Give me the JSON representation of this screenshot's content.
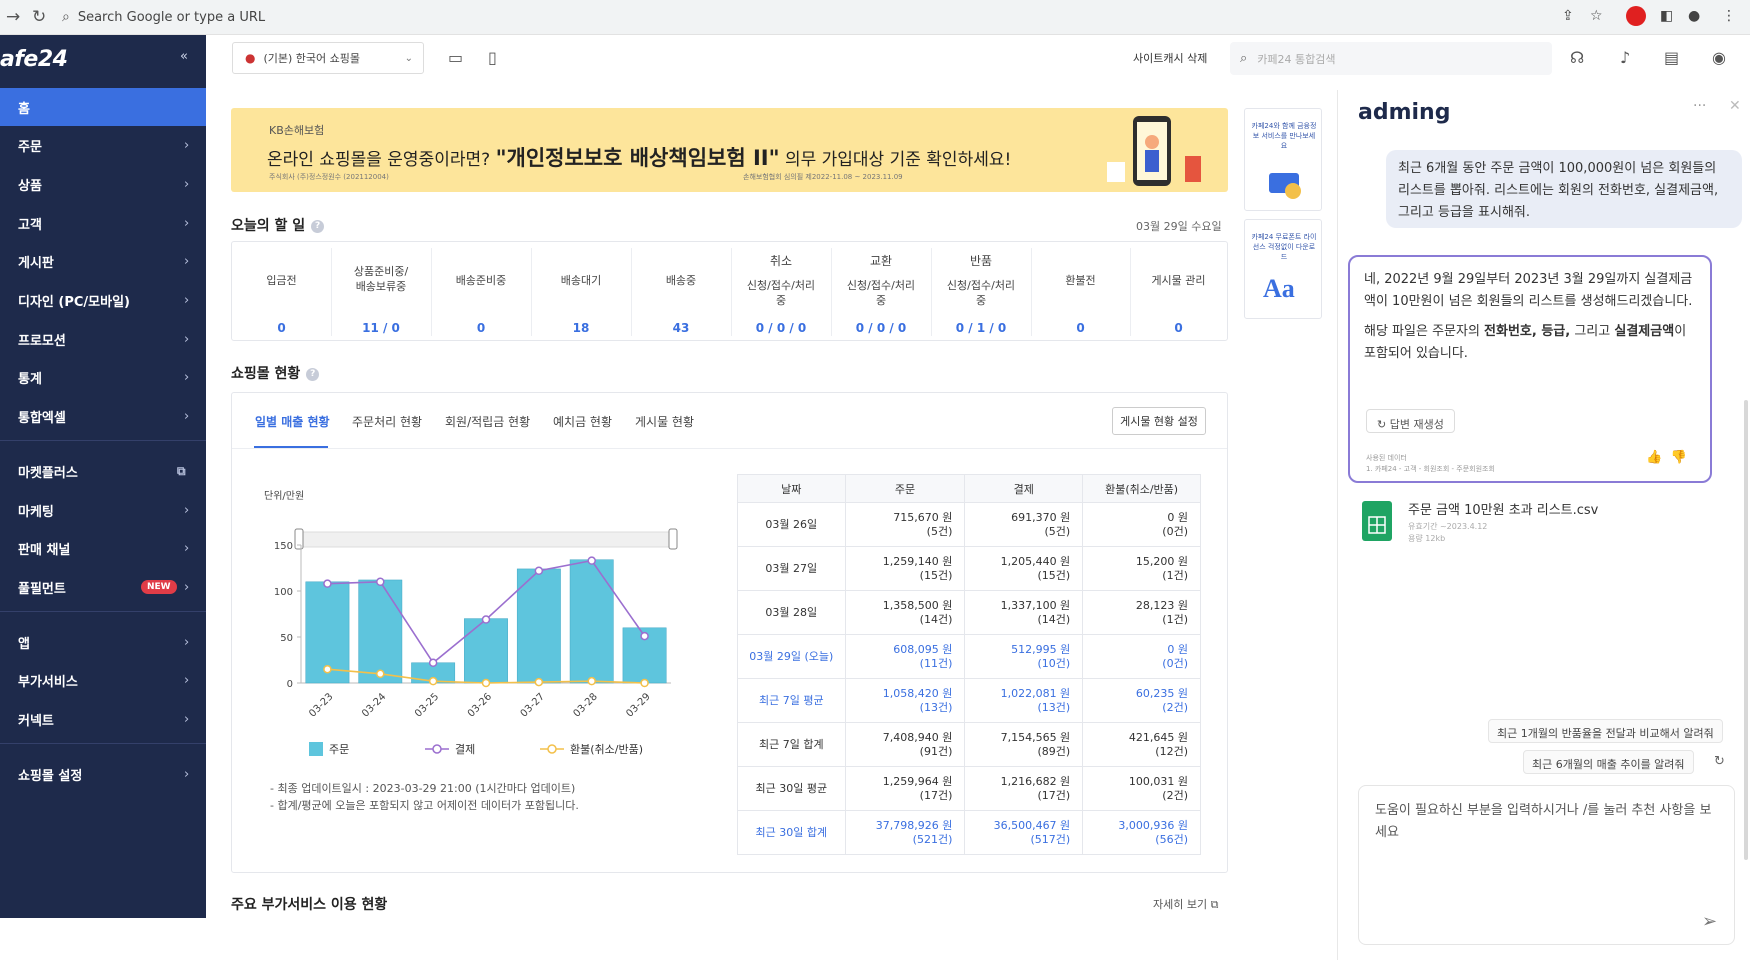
{
  "browser": {
    "url_placeholder": "Search Google or type a URL"
  },
  "sidebar": {
    "logo": "afe24",
    "items": [
      {
        "label": "홈"
      },
      {
        "label": "주문"
      },
      {
        "label": "상품"
      },
      {
        "label": "고객"
      },
      {
        "label": "게시판"
      },
      {
        "label": "디자인 (PC/모바일)"
      },
      {
        "label": "프로모션"
      },
      {
        "label": "통계"
      },
      {
        "label": "통합엑셀"
      },
      {
        "label": "마켓플러스"
      },
      {
        "label": "마케팅"
      },
      {
        "label": "판매 채널"
      },
      {
        "label": "풀필먼트",
        "badge": "NEW"
      },
      {
        "label": "앱"
      },
      {
        "label": "부가서비스"
      },
      {
        "label": "커넥트"
      },
      {
        "label": "쇼핑몰 설정"
      }
    ]
  },
  "header": {
    "shop_select": "(기본) 한국어 쇼핑몰",
    "site_cache": "사이트캐시 삭제",
    "search_placeholder": "카페24 통합검색"
  },
  "banner": {
    "brand": "KB손해보험",
    "lead": "온라인 쇼핑몰을 운영중이라면?",
    "highlight": "\"개인정보보호 배상책임보험 II\"",
    "tail": "의무 가입대상 기준 확인하세요!",
    "fine_left": "주식회사 (주)정스정원수 (202112004)",
    "fine_right": "손해보험협회 심의필 제2022-11.08 ~ 2023.11.09"
  },
  "side_ads": [
    {
      "text": "카페24와 함께 금융정보 서비스를 만나보세요"
    },
    {
      "text": "카페24 무료폰트 라이선스 걱정없이 다운로드"
    }
  ],
  "today": {
    "title": "오늘의 할 일",
    "date": "03월 29일 수요일",
    "columns": [
      {
        "label": "입금전",
        "value": "0"
      },
      {
        "label": "상품준비중/\n배송보류중",
        "value": "11 / 0"
      },
      {
        "label": "배송준비중",
        "value": "0"
      },
      {
        "label": "배송대기",
        "value": "18"
      },
      {
        "label": "배송중",
        "value": "43"
      },
      {
        "group": "취소",
        "label": "신청/접수/처리\n중",
        "value": "0 / 0 / 0"
      },
      {
        "group": "교환",
        "label": "신청/접수/처리\n중",
        "value": "0 / 0 / 0"
      },
      {
        "group": "반품",
        "label": "신청/접수/처리\n중",
        "value": "0 / 1 / 0"
      },
      {
        "label": "환불전",
        "value": "0"
      },
      {
        "label": "게시물 관리",
        "value": "0"
      }
    ]
  },
  "shop_status": {
    "title": "쇼핑몰 현황",
    "tabs": [
      "일별 매출 현황",
      "주문처리 현황",
      "회원/적립금 현황",
      "예치금 현황",
      "게시물 현황"
    ],
    "setting_button": "게시물 현황 설정",
    "unit_label": "단위/만원",
    "legend": [
      "주문",
      "결제",
      "환불(취소/반품)"
    ],
    "notes": [
      "- 최종 업데이트일시 : 2023-03-29 21:00 (1시간마다 업데이트)",
      "- 합계/평균에 오늘은 포함되지 않고 어제이전 데이터가 포함됩니다."
    ]
  },
  "chart_data": {
    "type": "bar",
    "categories": [
      "03-23",
      "03-24",
      "03-25",
      "03-26",
      "03-27",
      "03-28",
      "03-29"
    ],
    "series": [
      {
        "name": "주문",
        "type": "bar",
        "values": [
          110,
          112,
          22,
          70,
          124,
          134,
          60
        ]
      },
      {
        "name": "결제",
        "type": "line",
        "values": [
          108,
          110,
          22,
          69,
          122,
          133,
          51
        ]
      },
      {
        "name": "환불(취소/반품)",
        "type": "line",
        "values": [
          15,
          10,
          2,
          0,
          1,
          2,
          0
        ]
      }
    ],
    "xlabel": "",
    "ylabel": "단위/만원",
    "ylim": [
      0,
      150
    ],
    "yticks": [
      0,
      50,
      100,
      150
    ],
    "grid": false,
    "legend": "bottom",
    "colors": {
      "bar": "#5ec5dd",
      "line_pay": "#9b6fcf",
      "line_refund": "#f3c04a"
    }
  },
  "sales_table": {
    "headers": [
      "날짜",
      "주문",
      "결제",
      "환불(취소/반품)"
    ],
    "rows": [
      {
        "date": "03월 26일",
        "order": "715,670 원",
        "order_cnt": "(5건)",
        "pay": "691,370 원",
        "pay_cnt": "(5건)",
        "refund": "0 원",
        "refund_cnt": "(0건)"
      },
      {
        "date": "03월 27일",
        "order": "1,259,140 원",
        "order_cnt": "(15건)",
        "pay": "1,205,440 원",
        "pay_cnt": "(15건)",
        "refund": "15,200 원",
        "refund_cnt": "(1건)"
      },
      {
        "date": "03월 28일",
        "order": "1,358,500 원",
        "order_cnt": "(14건)",
        "pay": "1,337,100 원",
        "pay_cnt": "(14건)",
        "refund": "28,123 원",
        "refund_cnt": "(1건)"
      },
      {
        "date": "03월 29일 (오늘)",
        "order": "608,095 원",
        "order_cnt": "(11건)",
        "pay": "512,995 원",
        "pay_cnt": "(10건)",
        "refund": "0 원",
        "refund_cnt": "(0건)"
      },
      {
        "date": "최근 7일 평균",
        "order": "1,058,420 원",
        "order_cnt": "(13건)",
        "pay": "1,022,081 원",
        "pay_cnt": "(13건)",
        "refund": "60,235 원",
        "refund_cnt": "(2건)"
      },
      {
        "date": "최근 7일 합계",
        "order": "7,408,940 원",
        "order_cnt": "(91건)",
        "pay": "7,154,565 원",
        "pay_cnt": "(89건)",
        "refund": "421,645 원",
        "refund_cnt": "(12건)"
      },
      {
        "date": "최근 30일 평균",
        "order": "1,259,964 원",
        "order_cnt": "(17건)",
        "pay": "1,216,682 원",
        "pay_cnt": "(17건)",
        "refund": "100,031 원",
        "refund_cnt": "(2건)"
      },
      {
        "date": "최근 30일 합계",
        "order": "37,798,926 원",
        "order_cnt": "(521건)",
        "pay": "36,500,467 원",
        "pay_cnt": "(517건)",
        "refund": "3,000,936 원",
        "refund_cnt": "(56건)"
      }
    ]
  },
  "addon": {
    "title": "주요 부가서비스 이용 현황",
    "detail_link": "자세히 보기"
  },
  "assistant": {
    "title": "adming",
    "user_message": "최근 6개월 동안 주문 금액이 100,000원이 넘은 회원들의 리스트를 뽑아줘. 리스트에는 회원의 전화번호, 실결제금액, 그리고 등급을 표시해줘.",
    "reply_p1": "네, 2022년 9월 29일부터 2023년 3월 29일까지 실결제금액이 10만원이 넘은 회원들의 리스트를 생성해드리겠습니다.",
    "reply_p2_a": "해당 파일은 주문자의 ",
    "reply_p2_b": "전화번호, 등급,",
    "reply_p2_c": " 그리고 ",
    "reply_p2_d": "실결제금액",
    "reply_p2_e": "이 포함되어 있습니다.",
    "regen_button": "답변 재생성",
    "source_line1": "사용된 데이터",
    "source_line2": "1. 카페24 - 고객 - 회원조회 - 주문회원조회",
    "file_name": "주문 금액 10만원 초과 리스트.csv",
    "file_expiry": "유효기간 ~2023.4.12",
    "file_size": "용량 12kb",
    "suggestions": [
      "최근 1개월의 반품율을 전달과 비교해서 알려줘",
      "최근 6개월의 매출 추이를 알려줘"
    ],
    "input_placeholder": "도움이 필요하신 부분을 입력하시거나 /를 눌러 추천 사항을 보세요"
  }
}
